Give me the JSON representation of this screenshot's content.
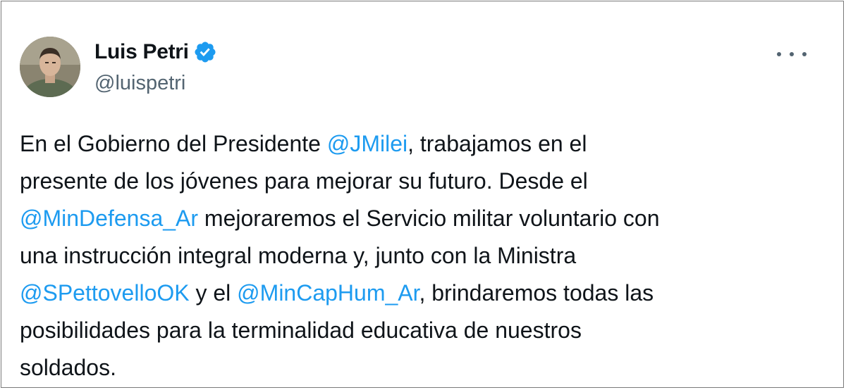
{
  "author": {
    "display_name": "Luis Petri",
    "handle": "@luispetri",
    "verified": true,
    "verified_icon": "verified-badge-icon",
    "avatar_icon": "profile-photo"
  },
  "menu": {
    "icon": "more-horizontal-icon"
  },
  "tweet": {
    "lines": [
      {
        "pre": "En el Gobierno del Presidente ",
        "mention": "@JMilei",
        "post": ", trabajamos en el"
      },
      {
        "text": "presente de los jóvenes para mejorar su futuro. Desde el"
      },
      {
        "mention": "@MinDefensa_Ar",
        "post": " mejoraremos el Servicio militar voluntario con"
      },
      {
        "text": "una instrucción integral moderna y, junto con la Ministra"
      },
      {
        "mention": "@SPettovelloOK",
        "mid": " y el ",
        "mention2": "@MinCapHum_Ar",
        "post": ", brindaremos todas las"
      },
      {
        "text": "posibilidades para la terminalidad educativa de nuestros"
      },
      {
        "text": "soldados."
      }
    ]
  },
  "colors": {
    "text": "#0f1419",
    "secondary": "#536471",
    "link": "#1d9bf0",
    "verified": "#1d9bf0"
  }
}
